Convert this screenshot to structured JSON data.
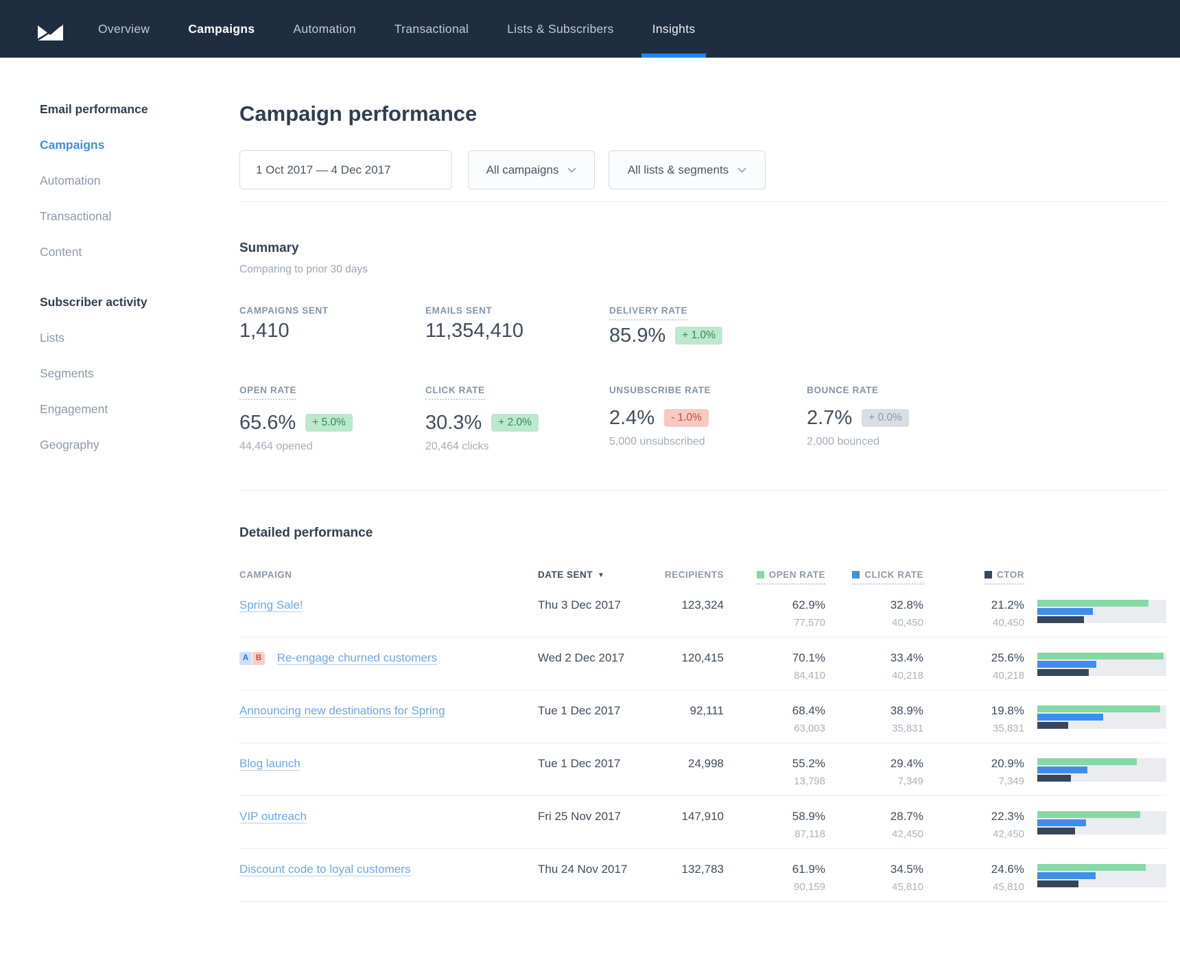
{
  "nav": {
    "logo": "campaign-monitor-logo",
    "tabs": [
      {
        "label": "Overview"
      },
      {
        "label": "Campaigns",
        "emphasis": true
      },
      {
        "label": "Automation"
      },
      {
        "label": "Transactional"
      },
      {
        "label": "Lists & Subscribers"
      },
      {
        "label": "Insights",
        "active": true
      }
    ]
  },
  "sidebar": {
    "sections": [
      {
        "heading": "Email performance",
        "items": [
          {
            "label": "Campaigns",
            "active": true
          },
          {
            "label": "Automation"
          },
          {
            "label": "Transactional"
          },
          {
            "label": "Content"
          }
        ]
      },
      {
        "heading": "Subscriber activity",
        "items": [
          {
            "label": "Lists"
          },
          {
            "label": "Segments"
          },
          {
            "label": "Engagement"
          },
          {
            "label": "Geography"
          }
        ]
      }
    ]
  },
  "page_title": "Campaign performance",
  "filters": {
    "date_range": "1 Oct 2017 — 4 Dec 2017",
    "campaigns": "All campaigns",
    "lists": "All lists & segments"
  },
  "summary": {
    "title": "Summary",
    "subtitle": "Comparing to prior 30 days",
    "stats_row1": [
      {
        "label": "CAMPAIGNS SENT",
        "value": "1,410"
      },
      {
        "label": "EMAILS SENT",
        "value": "11,354,410"
      },
      {
        "label": "DELIVERY RATE",
        "value": "85.9%",
        "delta": "+ 1.0%",
        "direction": "up",
        "tooltip": true
      }
    ],
    "stats_row2": [
      {
        "label": "OPEN RATE",
        "value": "65.6%",
        "delta": "+ 5.0%",
        "direction": "up",
        "sub": "44,464 opened",
        "tooltip": true
      },
      {
        "label": "CLICK RATE",
        "value": "30.3%",
        "delta": "+ 2.0%",
        "direction": "up",
        "sub": "20,464 clicks",
        "tooltip": true
      },
      {
        "label": "UNSUBSCRIBE RATE",
        "value": "2.4%",
        "delta": "- 1.0%",
        "direction": "down",
        "sub": "5,000 unsubscribed"
      },
      {
        "label": "BOUNCE RATE",
        "value": "2.7%",
        "delta": "+ 0.0%",
        "direction": "flat",
        "sub": "2,000 bounced"
      }
    ]
  },
  "table": {
    "title": "Detailed performance",
    "columns": [
      "CAMPAIGN",
      "DATE SENT",
      "RECIPIENTS",
      "OPEN RATE",
      "CLICK RATE",
      "CTOR"
    ],
    "legend_colors": {
      "open": "#85d9a6",
      "click": "#3f8deb",
      "ctor": "#36475c"
    },
    "sort_column": "DATE SENT",
    "rows": [
      {
        "name": "Spring Sale!",
        "date": "Thu 3 Dec 2017",
        "recipients": "123,324",
        "open_rate": "62.9%",
        "open_count": "77,570",
        "click_rate": "32.8%",
        "click_count": "40,450",
        "ctor": "21.2%",
        "ctor_count": "40,450",
        "bars": {
          "open": 86,
          "click": 43,
          "ctor": 36
        }
      },
      {
        "name": "Re-engage churned customers",
        "ab_test": [
          "A",
          "B"
        ],
        "date": "Wed 2 Dec 2017",
        "recipients": "120,415",
        "open_rate": "70.1%",
        "open_count": "84,410",
        "click_rate": "33.4%",
        "click_count": "40,218",
        "ctor": "25.6%",
        "ctor_count": "40,218",
        "bars": {
          "open": 98,
          "click": 46,
          "ctor": 40
        }
      },
      {
        "name": "Announcing new destinations for Spring",
        "date": "Tue 1 Dec 2017",
        "recipients": "92,111",
        "open_rate": "68.4%",
        "open_count": "63,003",
        "click_rate": "38.9%",
        "click_count": "35,831",
        "ctor": "19.8%",
        "ctor_count": "35,831",
        "bars": {
          "open": 95,
          "click": 51,
          "ctor": 24
        }
      },
      {
        "name": "Blog launch",
        "date": "Tue 1 Dec 2017",
        "recipients": "24,998",
        "open_rate": "55.2%",
        "open_count": "13,798",
        "click_rate": "29.4%",
        "click_count": "7,349",
        "ctor": "20.9%",
        "ctor_count": "7,349",
        "bars": {
          "open": 77,
          "click": 39,
          "ctor": 26
        }
      },
      {
        "name": "VIP outreach",
        "date": "Fri 25 Nov 2017",
        "recipients": "147,910",
        "open_rate": "58.9%",
        "open_count": "87,118",
        "click_rate": "28.7%",
        "click_count": "42,450",
        "ctor": "22.3%",
        "ctor_count": "42,450",
        "bars": {
          "open": 80,
          "click": 38,
          "ctor": 29
        }
      },
      {
        "name": "Discount code to loyal customers",
        "date": "Thu 24 Nov 2017",
        "recipients": "132,783",
        "open_rate": "61.9%",
        "open_count": "90,159",
        "click_rate": "34.5%",
        "click_count": "45,810",
        "ctor": "24.6%",
        "ctor_count": "45,810",
        "bars": {
          "open": 84,
          "click": 45,
          "ctor": 32
        }
      }
    ]
  },
  "colors": {
    "nav_bg": "#1f2d41",
    "accent_blue": "#1d86f2",
    "link_blue": "#6ea6e5",
    "bar_green": "#85d9a6",
    "bar_blue": "#3f8deb",
    "bar_dark": "#36475c",
    "badge_up_bg": "#bce8cd",
    "badge_up_text": "#2e8c57",
    "badge_down_bg": "#f7c9c3",
    "badge_down_text": "#d2473d",
    "badge_flat_bg": "#d9dee4",
    "badge_flat_text": "#8d98a5"
  }
}
